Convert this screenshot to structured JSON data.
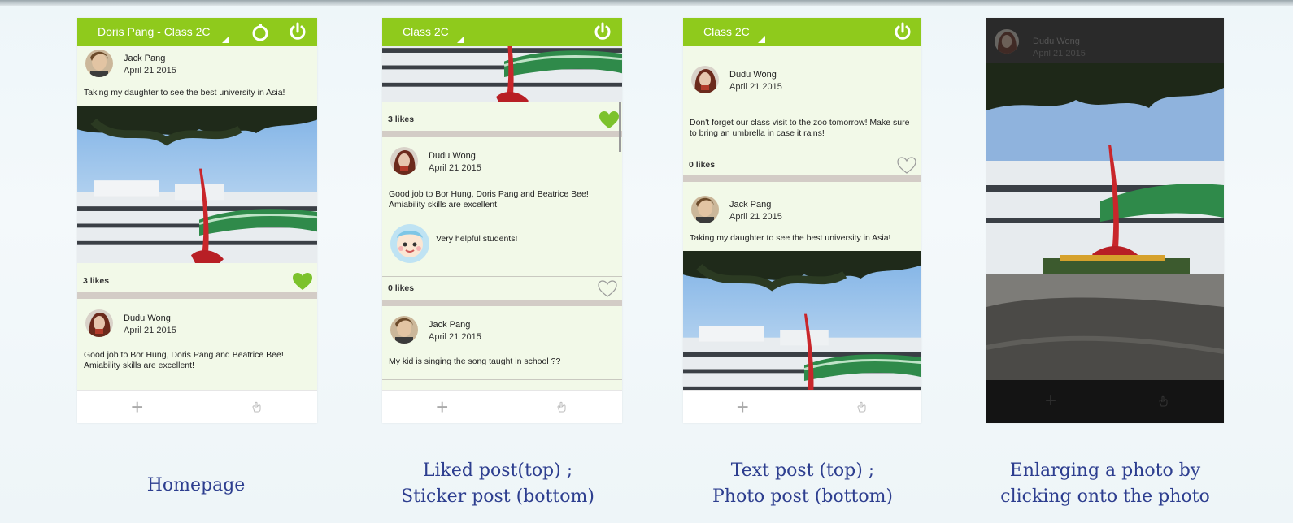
{
  "colors": {
    "accent_green": "#8fca1c",
    "post_bg": "#f2f9e8",
    "separator": "#d3ccc6",
    "caption_text": "#2d3e8f"
  },
  "screens": [
    {
      "id": "homepage",
      "app_title": "Doris Pang - Class 2C",
      "posts": [
        {
          "author": "Jack Pang",
          "date": "April 21 2015",
          "text": "Taking my daughter to see the best university in Asia!",
          "likes": "3 likes",
          "liked": true
        },
        {
          "author": "Dudu Wong",
          "date": "April 21 2015",
          "text": "Good job to Bor Hung, Doris Pang and Beatrice Bee! Amiability skills are excellent!"
        }
      ],
      "caption": "Homepage"
    },
    {
      "id": "liked-sticker",
      "app_title": "Class 2C",
      "posts": [
        {
          "likes": "3 likes",
          "liked": true
        },
        {
          "author": "Dudu Wong",
          "date": "April 21 2015",
          "text": "Good job to Bor Hung, Doris Pang and Beatrice Bee! Amiability skills are excellent!",
          "sticker_text": "Very helpful students!",
          "likes": "0 likes",
          "liked": false
        },
        {
          "author": "Jack Pang",
          "date": "April 21 2015",
          "text": "My kid is singing the song taught in school ??"
        }
      ],
      "caption_line1": "Liked post(top) ;",
      "caption_line2": "Sticker post (bottom)"
    },
    {
      "id": "text-photo",
      "app_title": "Class 2C",
      "posts": [
        {
          "author": "Dudu Wong",
          "date": "April 21 2015",
          "text": "Don't forget our class visit to the zoo tomorrow! Make sure to bring an umbrella in case it rains!",
          "likes": "0 likes",
          "liked": false
        },
        {
          "author": "Jack Pang",
          "date": "April 21 2015",
          "text": "Taking my daughter to see the best university in Asia!"
        }
      ],
      "caption_line1": "Text post (top) ;",
      "caption_line2": "Photo post (bottom)"
    },
    {
      "id": "enlarged-photo",
      "overlay_author": "Dudu Wong",
      "overlay_date": "April 21 2015",
      "caption_line1": "Enlarging a photo by",
      "caption_line2": "clicking onto the photo"
    }
  ],
  "icons": {
    "add": "+",
    "power": "power-icon",
    "timer": "timer-icon",
    "heart": "heart-icon",
    "hand": "hand-icon",
    "dropdown": "dropdown-triangle-icon"
  }
}
